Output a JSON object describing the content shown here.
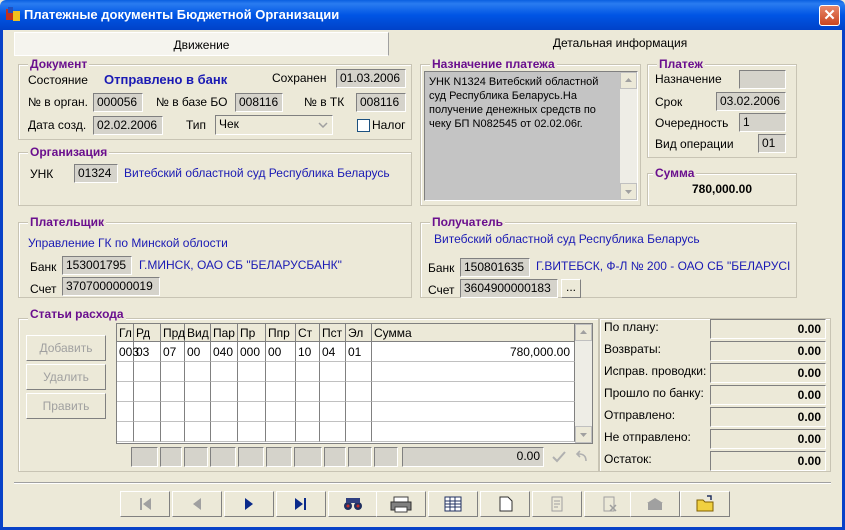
{
  "window": {
    "title": "Платежные документы Бюджетной Организации",
    "close": "✕"
  },
  "tabs": {
    "movement": "Движение",
    "details": "Детальная информация"
  },
  "document": {
    "group": "Документ",
    "state_label": "Состояние",
    "state_value": "Отправлено в банк",
    "saved_label": "Сохранен",
    "saved_value": "01.03.2006",
    "org_no_label": "№ в орган.",
    "org_no_value": "000056",
    "bo_no_label": "№ в базе БО",
    "bo_no_value": "008116",
    "tk_no_label": "№ в ТК",
    "tk_no_value": "008116",
    "created_label": "Дата созд.",
    "created_value": "02.02.2006",
    "type_label": "Тип",
    "type_value": "Чек",
    "tax_label": "Налог"
  },
  "purpose": {
    "group": "Назначение платежа",
    "text": "УНК N1324 Витебский областной суд Республика Беларусь.На получение денежных средств по чеку БП N082545 от 02.02.06г."
  },
  "payment": {
    "group": "Платеж",
    "purpose_label": "Назначение",
    "purpose_value": "",
    "term_label": "Срок",
    "term_value": "03.02.2006",
    "order_label": "Очередность",
    "order_value": "1",
    "optype_label": "Вид операции",
    "optype_value": "01"
  },
  "organization": {
    "group": "Организация",
    "unk_label": "УНК",
    "unk_value": "01324",
    "name": "Витебский областной суд Республика Беларусь"
  },
  "sum": {
    "group": "Сумма",
    "value": "780,000.00"
  },
  "payer": {
    "group": "Плательщик",
    "name": "Управление ГК по Минской облости",
    "bank_label": "Банк",
    "bank_code": "153001795",
    "bank_name": "Г.МИНСК, ОАО СБ \"БЕЛАРУСБАНК\"",
    "account_label": "Счет",
    "account_value": "3707000000019"
  },
  "recipient": {
    "group": "Получатель",
    "name": "Витебский областной суд Республика Беларусь",
    "bank_label": "Банк",
    "bank_code": "150801635",
    "bank_name": "Г.ВИТЕБСК, Ф-Л № 200 - ОАО СБ \"БЕЛАРУСІ",
    "account_label": "Счет",
    "account_value": "3604900000183",
    "more": "..."
  },
  "expenses": {
    "group": "Статьи расхода",
    "add": "Добавить",
    "delete": "Удалить",
    "edit": "Править",
    "columns": [
      "Гл",
      "Рд",
      "Прд",
      "Вид",
      "Пар",
      "Пр",
      "Ппр",
      "Ст",
      "Пст",
      "Эл",
      "Сумма"
    ],
    "rows": [
      [
        "003",
        "03",
        "07",
        "00",
        "040",
        "000",
        "00",
        "10",
        "04",
        "01",
        "780,000.00"
      ]
    ],
    "footer_total": "0.00"
  },
  "totals": [
    {
      "label": "По плану:",
      "value": "0.00"
    },
    {
      "label": "Возвраты:",
      "value": "0.00"
    },
    {
      "label": "Исправ. проводки:",
      "value": "0.00"
    },
    {
      "label": "Прошло по банку:",
      "value": "0.00"
    },
    {
      "label": "Отправлено:",
      "value": "0.00"
    },
    {
      "label": "Не отправлено:",
      "value": "0.00"
    },
    {
      "label": "Остаток:",
      "value": "0.00"
    }
  ]
}
